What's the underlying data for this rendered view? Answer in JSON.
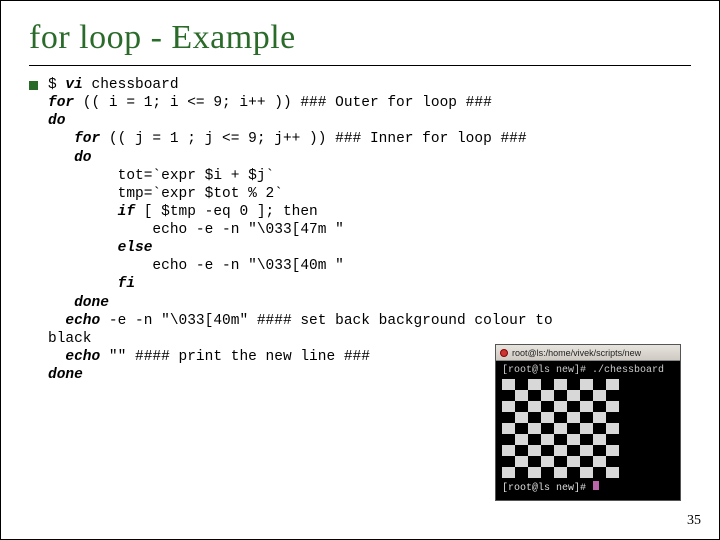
{
  "title": "for loop - Example",
  "code": {
    "l1a": "$ ",
    "l1b": "vi",
    "l1c": " chessboard",
    "l2a": "for",
    "l2b": " (( i = 1; i <= 9; i++ )) ### Outer for loop ###",
    "l3a": "do",
    "l4a": "   ",
    "l4b": "for",
    "l4c": " (( j = 1 ; j <= 9; j++ )) ### Inner for loop ###",
    "l5a": "   ",
    "l5b": "do",
    "l6": "        tot=`expr $i + $j`",
    "l7": "        tmp=`expr $tot % 2`",
    "l8a": "        ",
    "l8b": "if",
    "l8c": " [ $tmp -eq 0 ]; then",
    "l9": "            echo -e -n \"\\033[47m \"",
    "l10a": "        ",
    "l10b": "else",
    "l11": "            echo -e -n \"\\033[40m \"",
    "l12a": "        ",
    "l12b": "fi",
    "l13a": "   ",
    "l13b": "done",
    "l14a": "  ",
    "l14b": "echo",
    "l14c": " -e -n \"\\033[40m\" #### set back background colour to",
    "l15": "black",
    "l16a": "  ",
    "l16b": "echo",
    "l16c": " \"\" #### print the new line ###",
    "l17a": "done"
  },
  "terminal": {
    "title": "root@ls:/home/vivek/scripts/new",
    "line1": "[root@ls new]# ./chessboard",
    "line2": "[root@ls new]# "
  },
  "page_number": "35"
}
